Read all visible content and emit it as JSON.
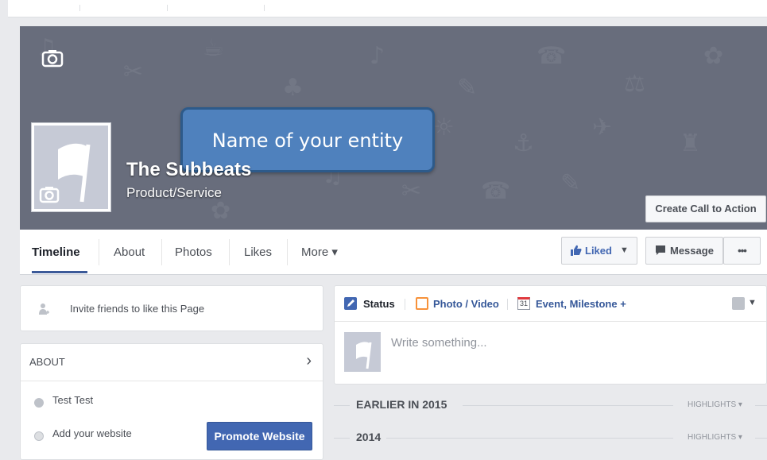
{
  "cover": {
    "callout_text": "Name of your entity",
    "cta_label": "Create Call to Action",
    "page_name": "The Subbeats",
    "page_category": "Product/Service"
  },
  "tabs": [
    {
      "label": "Timeline",
      "active": true
    },
    {
      "label": "About"
    },
    {
      "label": "Photos"
    },
    {
      "label": "Likes"
    },
    {
      "label": "More ▾"
    }
  ],
  "actions": {
    "liked_label": "Liked",
    "message_label": "Message",
    "more_label": "•••"
  },
  "left": {
    "invite_text": "Invite friends to like this Page",
    "about_title": "ABOUT",
    "about_items": [
      "Test Test",
      "Add your website"
    ],
    "promote_label": "Promote Website"
  },
  "composer": {
    "tab_status": "Status",
    "tab_photo": "Photo / Video",
    "tab_event": "Event, Milestone +",
    "event_day": "31",
    "placeholder": "Write something..."
  },
  "timeline": [
    {
      "label": "EARLIER IN 2015",
      "highlights": "HIGHLIGHTS ▾"
    },
    {
      "label": "2014",
      "highlights": "HIGHLIGHTS ▾"
    }
  ],
  "colors": {
    "brand_blue": "#3b5998",
    "button_blue": "#4267b2",
    "cover_gray": "#686d7c",
    "callout_blue": "#4f81bd"
  }
}
